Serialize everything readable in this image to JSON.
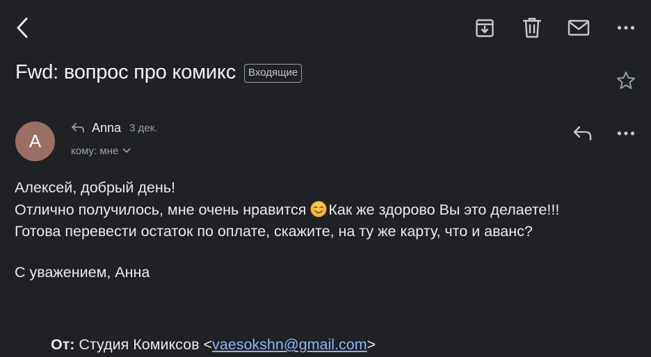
{
  "toolbar": {
    "back_icon": "chevron-left-icon",
    "archive_icon": "archive-icon",
    "delete_icon": "trash-icon",
    "mark_unread_icon": "envelope-icon",
    "more_icon": "more-horizontal-icon"
  },
  "email": {
    "subject": "Fwd: вопрос про комикс",
    "label": "Входящие",
    "star_icon": "star-outline-icon",
    "sender": {
      "avatar_letter": "A",
      "avatar_color": "#9b6f63",
      "name": "Anna",
      "date": "3 дек.",
      "recipient": "кому: мне"
    },
    "body": {
      "line1": "Алексей, добрый день!",
      "line2_before_emoji": "Отлично получилось, мне очень нравится ",
      "emoji": "smiling-face-emoji",
      "line2_after_emoji": "Как же здорово Вы это делаете!!!",
      "line3": "Готова перевести остаток по оплате, скажите, на ту же карту, что и аванс?",
      "signature": "С уважением, Анна"
    },
    "forwarded": {
      "from_label": "От:",
      "from_name": " Студия Комиксов <",
      "from_email": "vaesokshn@gmail.com",
      "from_close": ">"
    }
  },
  "colors": {
    "background": "#202124",
    "text": "#e8eaed",
    "secondary_text": "#9aa0a6",
    "link": "#8ab4f8"
  }
}
